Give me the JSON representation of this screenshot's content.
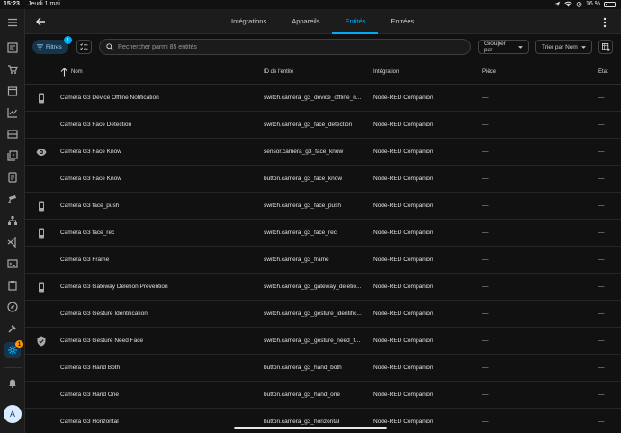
{
  "status": {
    "time": "15:23",
    "date": "Jeudi 1 mai",
    "battery": "16 %"
  },
  "tabs": [
    {
      "label": "Intégrations",
      "active": false
    },
    {
      "label": "Appareils",
      "active": false
    },
    {
      "label": "Entités",
      "active": true
    },
    {
      "label": "Entrées",
      "active": false
    }
  ],
  "toolbar": {
    "filters_label": "Filtres",
    "filters_badge": "1",
    "search_placeholder": "Rechercher parmi 85 entités",
    "group_by_label": "Grouper par",
    "sort_by_label": "Trier par Nom"
  },
  "sidebar": {
    "avatar_letter": "A",
    "settings_badge": "1"
  },
  "table": {
    "headers": {
      "name": "Nom",
      "entity_id": "ID de l'entité",
      "integration": "Intégration",
      "area": "Pièce",
      "state": "État"
    },
    "rows": [
      {
        "icon": "mobile-icon",
        "name": "Camera G3 Device Offline Notification",
        "entity_id": "switch.camera_g3_device_offline_n...",
        "integration": "Node-RED Companion",
        "area": "—",
        "state": "—"
      },
      {
        "icon": "",
        "name": "Camera G3 Face Detection",
        "entity_id": "switch.camera_g3_face_detection",
        "integration": "Node-RED Companion",
        "area": "—",
        "state": "—"
      },
      {
        "icon": "eye-icon",
        "name": "Camera G3 Face Know",
        "entity_id": "sensor.camera_g3_face_know",
        "integration": "Node-RED Companion",
        "area": "—",
        "state": "—"
      },
      {
        "icon": "",
        "name": "Camera G3 Face Know",
        "entity_id": "button.camera_g3_face_know",
        "integration": "Node-RED Companion",
        "area": "—",
        "state": "—"
      },
      {
        "icon": "mobile-icon",
        "name": "Camera G3 face_push",
        "entity_id": "switch.camera_g3_face_push",
        "integration": "Node-RED Companion",
        "area": "—",
        "state": "—"
      },
      {
        "icon": "mobile-icon",
        "name": "Camera G3 face_rec",
        "entity_id": "switch.camera_g3_face_rec",
        "integration": "Node-RED Companion",
        "area": "—",
        "state": "—"
      },
      {
        "icon": "",
        "name": "Camera G3 Frame",
        "entity_id": "switch.camera_g3_frame",
        "integration": "Node-RED Companion",
        "area": "—",
        "state": "—"
      },
      {
        "icon": "mobile-icon",
        "name": "Camera G3 Gateway Deletion Prevention",
        "entity_id": "switch.camera_g3_gateway_deletio...",
        "integration": "Node-RED Companion",
        "area": "—",
        "state": "—"
      },
      {
        "icon": "",
        "name": "Camera G3 Gesture Identification",
        "entity_id": "switch.camera_g3_gesture_identific...",
        "integration": "Node-RED Companion",
        "area": "—",
        "state": "—"
      },
      {
        "icon": "shield-check-icon",
        "name": "Camera G3 Gesture Need Face",
        "entity_id": "switch.camera_g3_gesture_need_fa...",
        "integration": "Node-RED Companion",
        "area": "—",
        "state": "—"
      },
      {
        "icon": "",
        "name": "Camera G3 Hand Both",
        "entity_id": "button.camera_g3_hand_both",
        "integration": "Node-RED Companion",
        "area": "—",
        "state": "—"
      },
      {
        "icon": "",
        "name": "Camera G3 Hand One",
        "entity_id": "button.camera_g3_hand_one",
        "integration": "Node-RED Companion",
        "area": "—",
        "state": "—"
      },
      {
        "icon": "",
        "name": "Camera G3 Horizontal",
        "entity_id": "button.camera_g3_horizontal",
        "integration": "Node-RED Companion",
        "area": "—",
        "state": "—"
      }
    ]
  },
  "colors": {
    "accent": "#03a9f4",
    "background": "#111111",
    "sidebar": "#1c1c1c",
    "badge": "#ff9800"
  }
}
